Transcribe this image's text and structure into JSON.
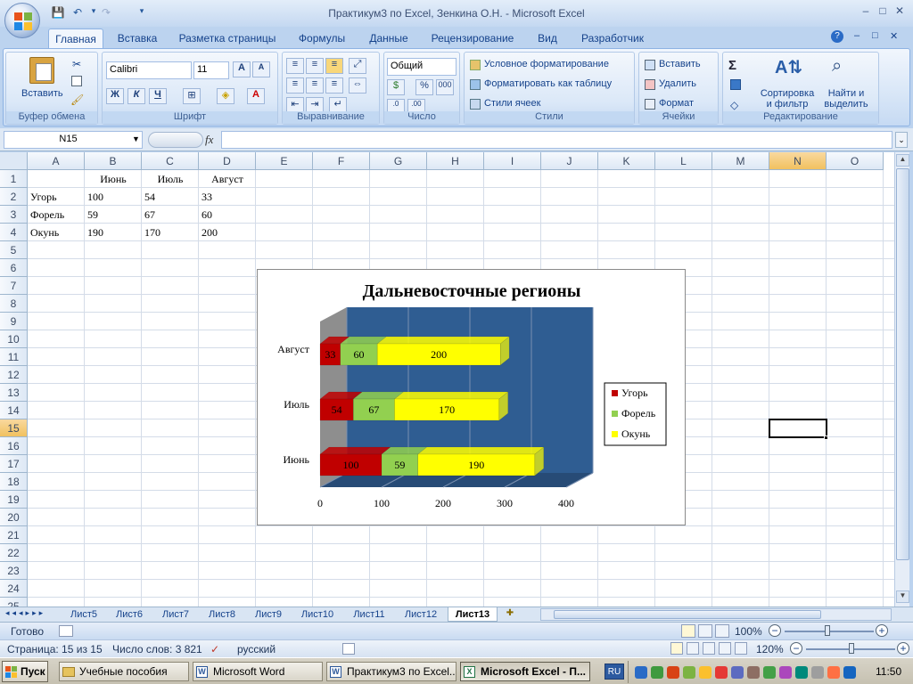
{
  "titlebar": {
    "title": "Практикум3 по Excel, Зенкина О.Н. - Microsoft Excel",
    "minimize": "–",
    "maximize": "□",
    "close": "✕",
    "qat_save": "💾",
    "qat_undo": "↶",
    "qat_redo": "↷",
    "qat_menu": "▾"
  },
  "tabs": [
    "Главная",
    "Вставка",
    "Разметка страницы",
    "Формулы",
    "Данные",
    "Рецензирование",
    "Вид",
    "Разработчик"
  ],
  "ribbon": {
    "clipboard": {
      "label": "Буфер обмена",
      "paste": "Вставить"
    },
    "font": {
      "label": "Шрифт",
      "name": "Calibri",
      "size": "11",
      "bold": "Ж",
      "italic": "К",
      "underline": "Ч"
    },
    "alignment": {
      "label": "Выравнивание"
    },
    "number": {
      "label": "Число",
      "format": "Общий",
      "percent": "%",
      "thousands": "000"
    },
    "styles": {
      "label": "Стили",
      "conditional": "Условное форматирование",
      "as_table": "Форматировать как таблицу",
      "cell_styles": "Стили ячеек"
    },
    "cells": {
      "label": "Ячейки",
      "insert": "Вставить",
      "delete": "Удалить",
      "format": "Формат"
    },
    "editing": {
      "label": "Редактирование",
      "sum": "Σ",
      "sort": "Сортировка и фильтр",
      "find": "Найти и выделить"
    }
  },
  "formula_bar": {
    "name_box": "N15",
    "fx": "fx",
    "value": ""
  },
  "grid": {
    "columns": [
      "A",
      "B",
      "C",
      "D",
      "E",
      "F",
      "G",
      "H",
      "I",
      "J",
      "K",
      "L",
      "M",
      "N",
      "O"
    ],
    "selected_column": "N",
    "selected_row": "15",
    "rows": [
      "1",
      "2",
      "3",
      "4",
      "5",
      "6",
      "7",
      "8",
      "9",
      "10",
      "11",
      "12",
      "13",
      "14",
      "15",
      "16",
      "17",
      "18",
      "19",
      "20",
      "21",
      "22",
      "23",
      "24",
      "25"
    ],
    "cells": {
      "B1": "Июнь",
      "C1": "Июль",
      "D1": "Август",
      "A2": "Угорь",
      "B2": "100",
      "C2": "54",
      "D2": "33",
      "A3": "Форель",
      "B3": "59",
      "C3": "67",
      "D3": "60",
      "A4": "Окунь",
      "B4": "190",
      "C4": "170",
      "D4": "200"
    }
  },
  "chart_data": {
    "type": "bar",
    "orientation": "horizontal",
    "stacked": true,
    "three_d": true,
    "title": "Дальневосточные регионы",
    "categories": [
      "Июнь",
      "Июль",
      "Август"
    ],
    "series": [
      {
        "name": "Угорь",
        "values": [
          100,
          54,
          33
        ],
        "color": "#c00000"
      },
      {
        "name": "Форель",
        "values": [
          59,
          67,
          60
        ],
        "color": "#92d050"
      },
      {
        "name": "Окунь",
        "values": [
          190,
          170,
          200
        ],
        "color": "#ffff00"
      }
    ],
    "xlim": [
      0,
      400
    ],
    "xticks": [
      "0",
      "100",
      "200",
      "300",
      "400"
    ],
    "plot_background": "#2f5d92",
    "grid": true,
    "legend_position": "right"
  },
  "sheet_tabs": [
    "Лист5",
    "Лист6",
    "Лист7",
    "Лист8",
    "Лист9",
    "Лист10",
    "Лист11",
    "Лист12",
    "Лист13"
  ],
  "active_sheet": "Лист13",
  "status": {
    "ready": "Готово",
    "zoom": "100%",
    "page": "Страница: 15 из 15",
    "words": "Число слов: 3 821",
    "language": "русский",
    "zoom2": "120%"
  },
  "taskbar": {
    "start": "Пуск",
    "buttons": [
      "Учебные пособия",
      "Microsoft Word",
      "Практикум3 по Excel...",
      "Microsoft Excel - П..."
    ],
    "lang": "RU",
    "clock": "11:50"
  }
}
